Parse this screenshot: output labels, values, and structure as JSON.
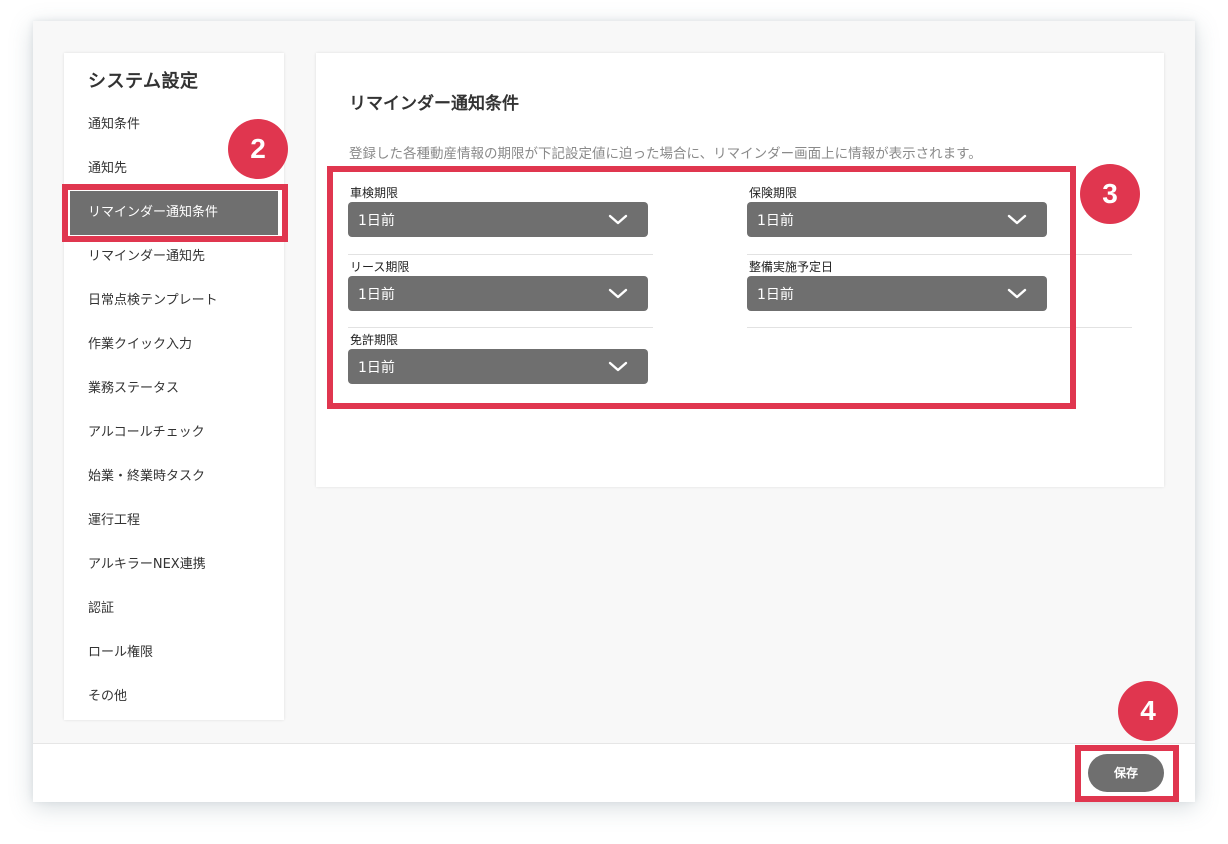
{
  "sidebar": {
    "title": "システム設定",
    "items": [
      {
        "label": "通知条件"
      },
      {
        "label": "通知先"
      },
      {
        "label": "リマインダー通知条件",
        "active": true
      },
      {
        "label": "リマインダー通知先"
      },
      {
        "label": "日常点検テンプレート"
      },
      {
        "label": "作業クイック入力"
      },
      {
        "label": "業務ステータス"
      },
      {
        "label": "アルコールチェック"
      },
      {
        "label": "始業・終業時タスク"
      },
      {
        "label": "運行工程"
      },
      {
        "label": "アルキラーNEX連携"
      },
      {
        "label": "認証"
      },
      {
        "label": "ロール権限"
      },
      {
        "label": "その他"
      }
    ]
  },
  "main": {
    "title": "リマインダー通知条件",
    "description": "登録した各種動産情報の期限が下記設定値に迫った場合に、リマインダー画面上に情報が表示されます。",
    "fields": [
      {
        "label": "車検期限",
        "value": "1日前"
      },
      {
        "label": "保険期限",
        "value": "1日前"
      },
      {
        "label": "リース期限",
        "value": "1日前"
      },
      {
        "label": "整備実施予定日",
        "value": "1日前"
      },
      {
        "label": "免許期限",
        "value": "1日前"
      }
    ]
  },
  "footer": {
    "save_label": "保存"
  },
  "annotations": {
    "badges": [
      "2",
      "3",
      "4"
    ],
    "accent_color": "#e0364f"
  },
  "colors": {
    "select_bg": "#6f6f6f",
    "active_item_bg": "#6f6f6f",
    "description_text": "#8a8a8a"
  }
}
